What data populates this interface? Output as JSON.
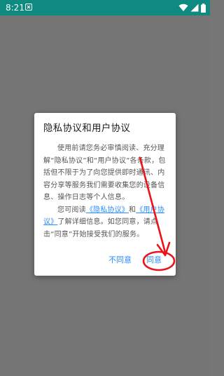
{
  "status_bar": {
    "time": "8:21",
    "icons": [
      "notification-icon",
      "wifi-icon",
      "signal-icon",
      "battery-icon"
    ],
    "background": "#0f8a80"
  },
  "dialog": {
    "title": "隐私协议和用户协议",
    "paragraph1": "使用前请您务必审慎阅读、充分理解“隐私协议”和“用户协议”各条款，包括但不限于为了向您提供即时通讯、内容分享等服务我们需要收集您的设备信息、操作日志等个人信息。",
    "paragraph2_prefix": "您可阅读",
    "privacy_link": "《隐私协议》",
    "and_text": "和",
    "user_link": "《用户协议》",
    "paragraph2_suffix": "了解详细信息。如您同意，请点击“同意”开始接受我们的服务。",
    "disagree_label": "不同意",
    "agree_label": "同意",
    "link_color": "#2a8cff"
  },
  "annotation": {
    "type": "red-arrow-and-circle",
    "target": "agree-button",
    "color": "#e8141a"
  }
}
